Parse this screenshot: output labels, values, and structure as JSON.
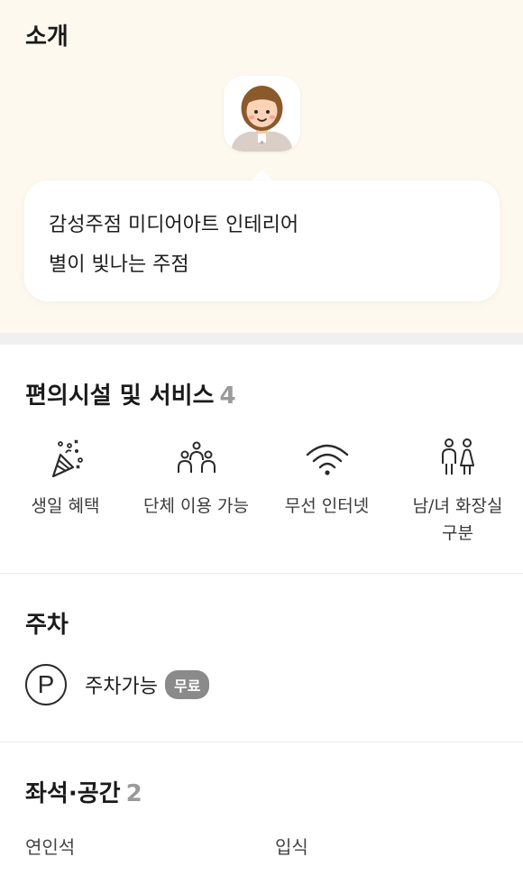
{
  "intro": {
    "title": "소개",
    "bubble_lines": [
      "감성주점 미디어아트 인테리어",
      "별이 빛나는 주점"
    ]
  },
  "amenities": {
    "title": "편의시설 및 서비스",
    "count": "4",
    "items": [
      {
        "icon": "party-popper-icon",
        "label": "생일 혜택"
      },
      {
        "icon": "group-icon",
        "label": "단체 이용 가능"
      },
      {
        "icon": "wifi-icon",
        "label": "무선 인터넷"
      },
      {
        "icon": "restroom-icon",
        "label_line1": "남/녀 화장실",
        "label_line2": "구분"
      }
    ]
  },
  "parking": {
    "title": "주차",
    "icon_letter": "P",
    "text": "주차가능",
    "badge": "무료"
  },
  "seats": {
    "title": "좌석·공간",
    "count": "2",
    "items": [
      "연인석",
      "입식"
    ]
  },
  "colors": {
    "intro_bg": "#fdf9ef",
    "badge_bg": "#8a8a8a",
    "count_gray": "#9a9a9a"
  }
}
